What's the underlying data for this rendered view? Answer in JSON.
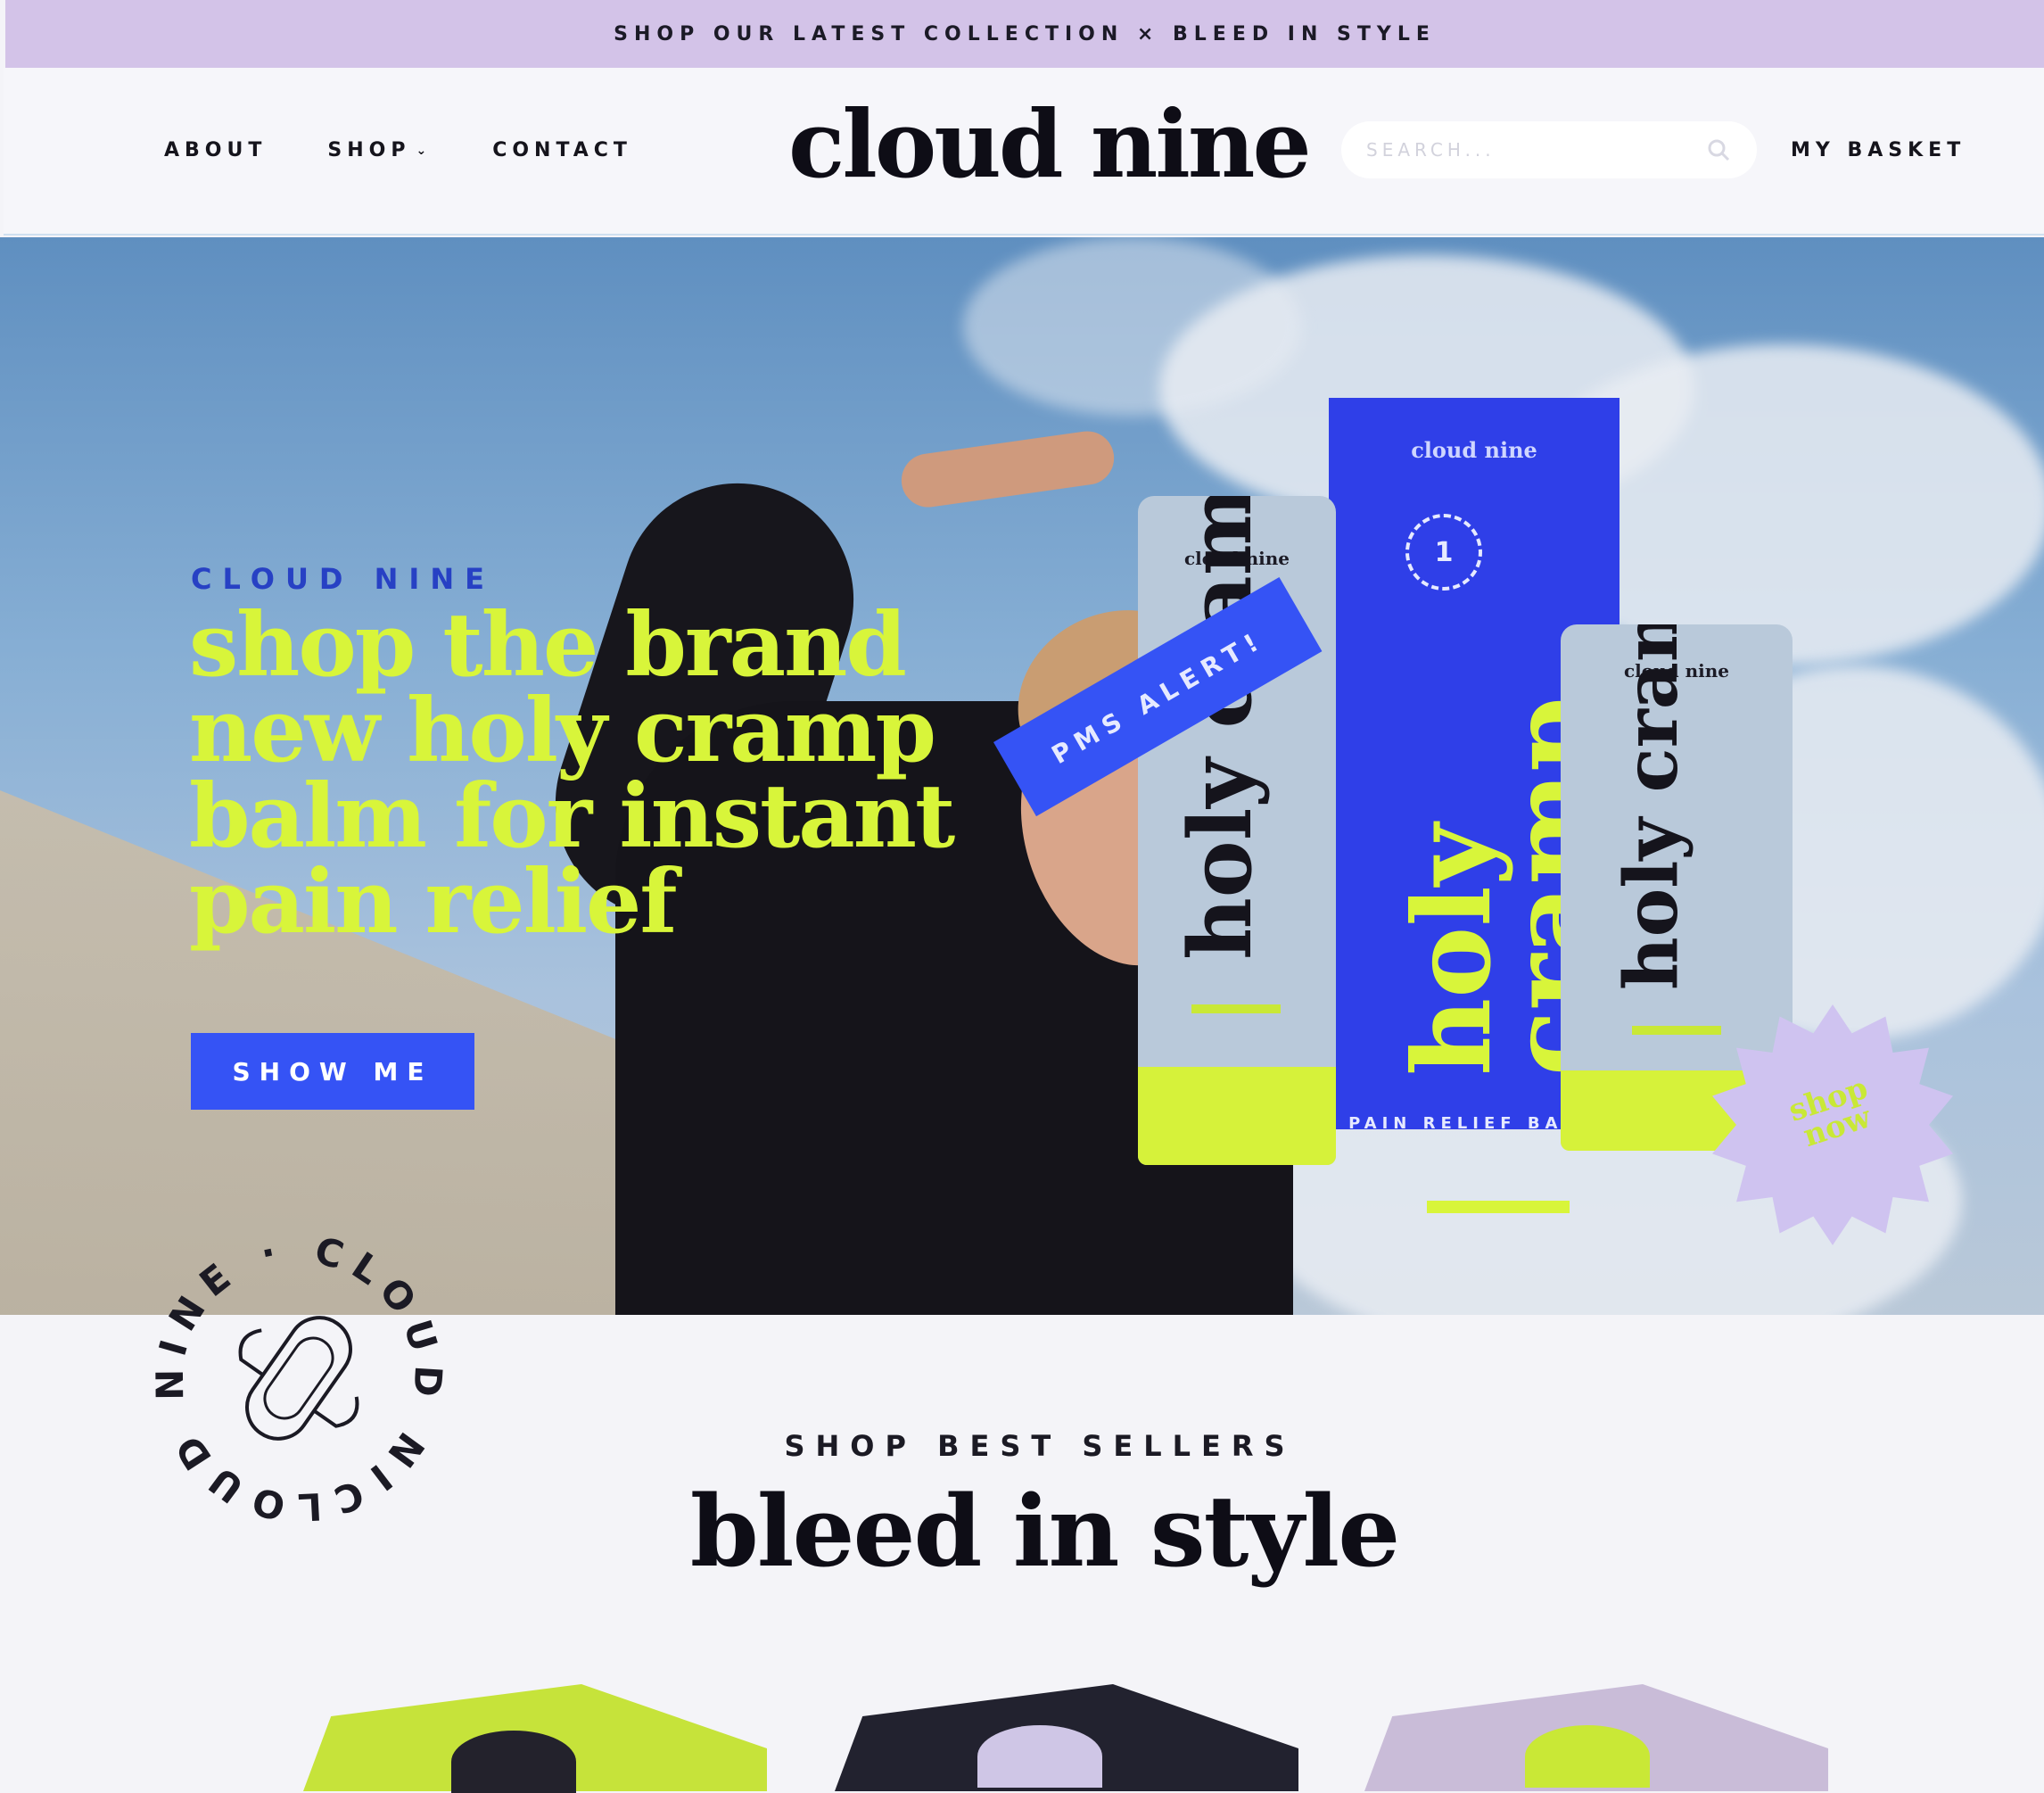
{
  "announcement": {
    "text": "SHOP OUR LATEST COLLECTION × BLEED IN STYLE"
  },
  "header": {
    "nav": {
      "about": "ABOUT",
      "shop": "SHOP",
      "contact": "CONTACT"
    },
    "logo": "cloud nine",
    "search": {
      "placeholder": "SEARCH..."
    },
    "basket": "MY BASKET"
  },
  "hero": {
    "eyebrow": "CLOUD NINE",
    "headline": "shop the brand new holy cramp balm for instant pain relief",
    "cta": "SHOW ME",
    "tag": "PMS ALERT!",
    "box": {
      "logo": "cloud nine",
      "title": "holy cramp",
      "label": "PAIN RELIEF BALM",
      "badge": "1"
    },
    "tube_left": {
      "logo": "cloud nine",
      "title": "holy cramp"
    },
    "tube_right": {
      "logo": "cloud nine",
      "title": "holy cramp"
    },
    "sticker": "shop now"
  },
  "badge_ring": {
    "text": "CLOUD NINE · CLOUD NINE ·"
  },
  "best_sellers": {
    "eyebrow": "SHOP BEST SELLERS",
    "title": "bleed in style"
  },
  "colors": {
    "accent_blue": "#3553f5",
    "lime": "#d8f53a",
    "lavender": "#d3c3e8",
    "ink": "#0e0d16"
  }
}
